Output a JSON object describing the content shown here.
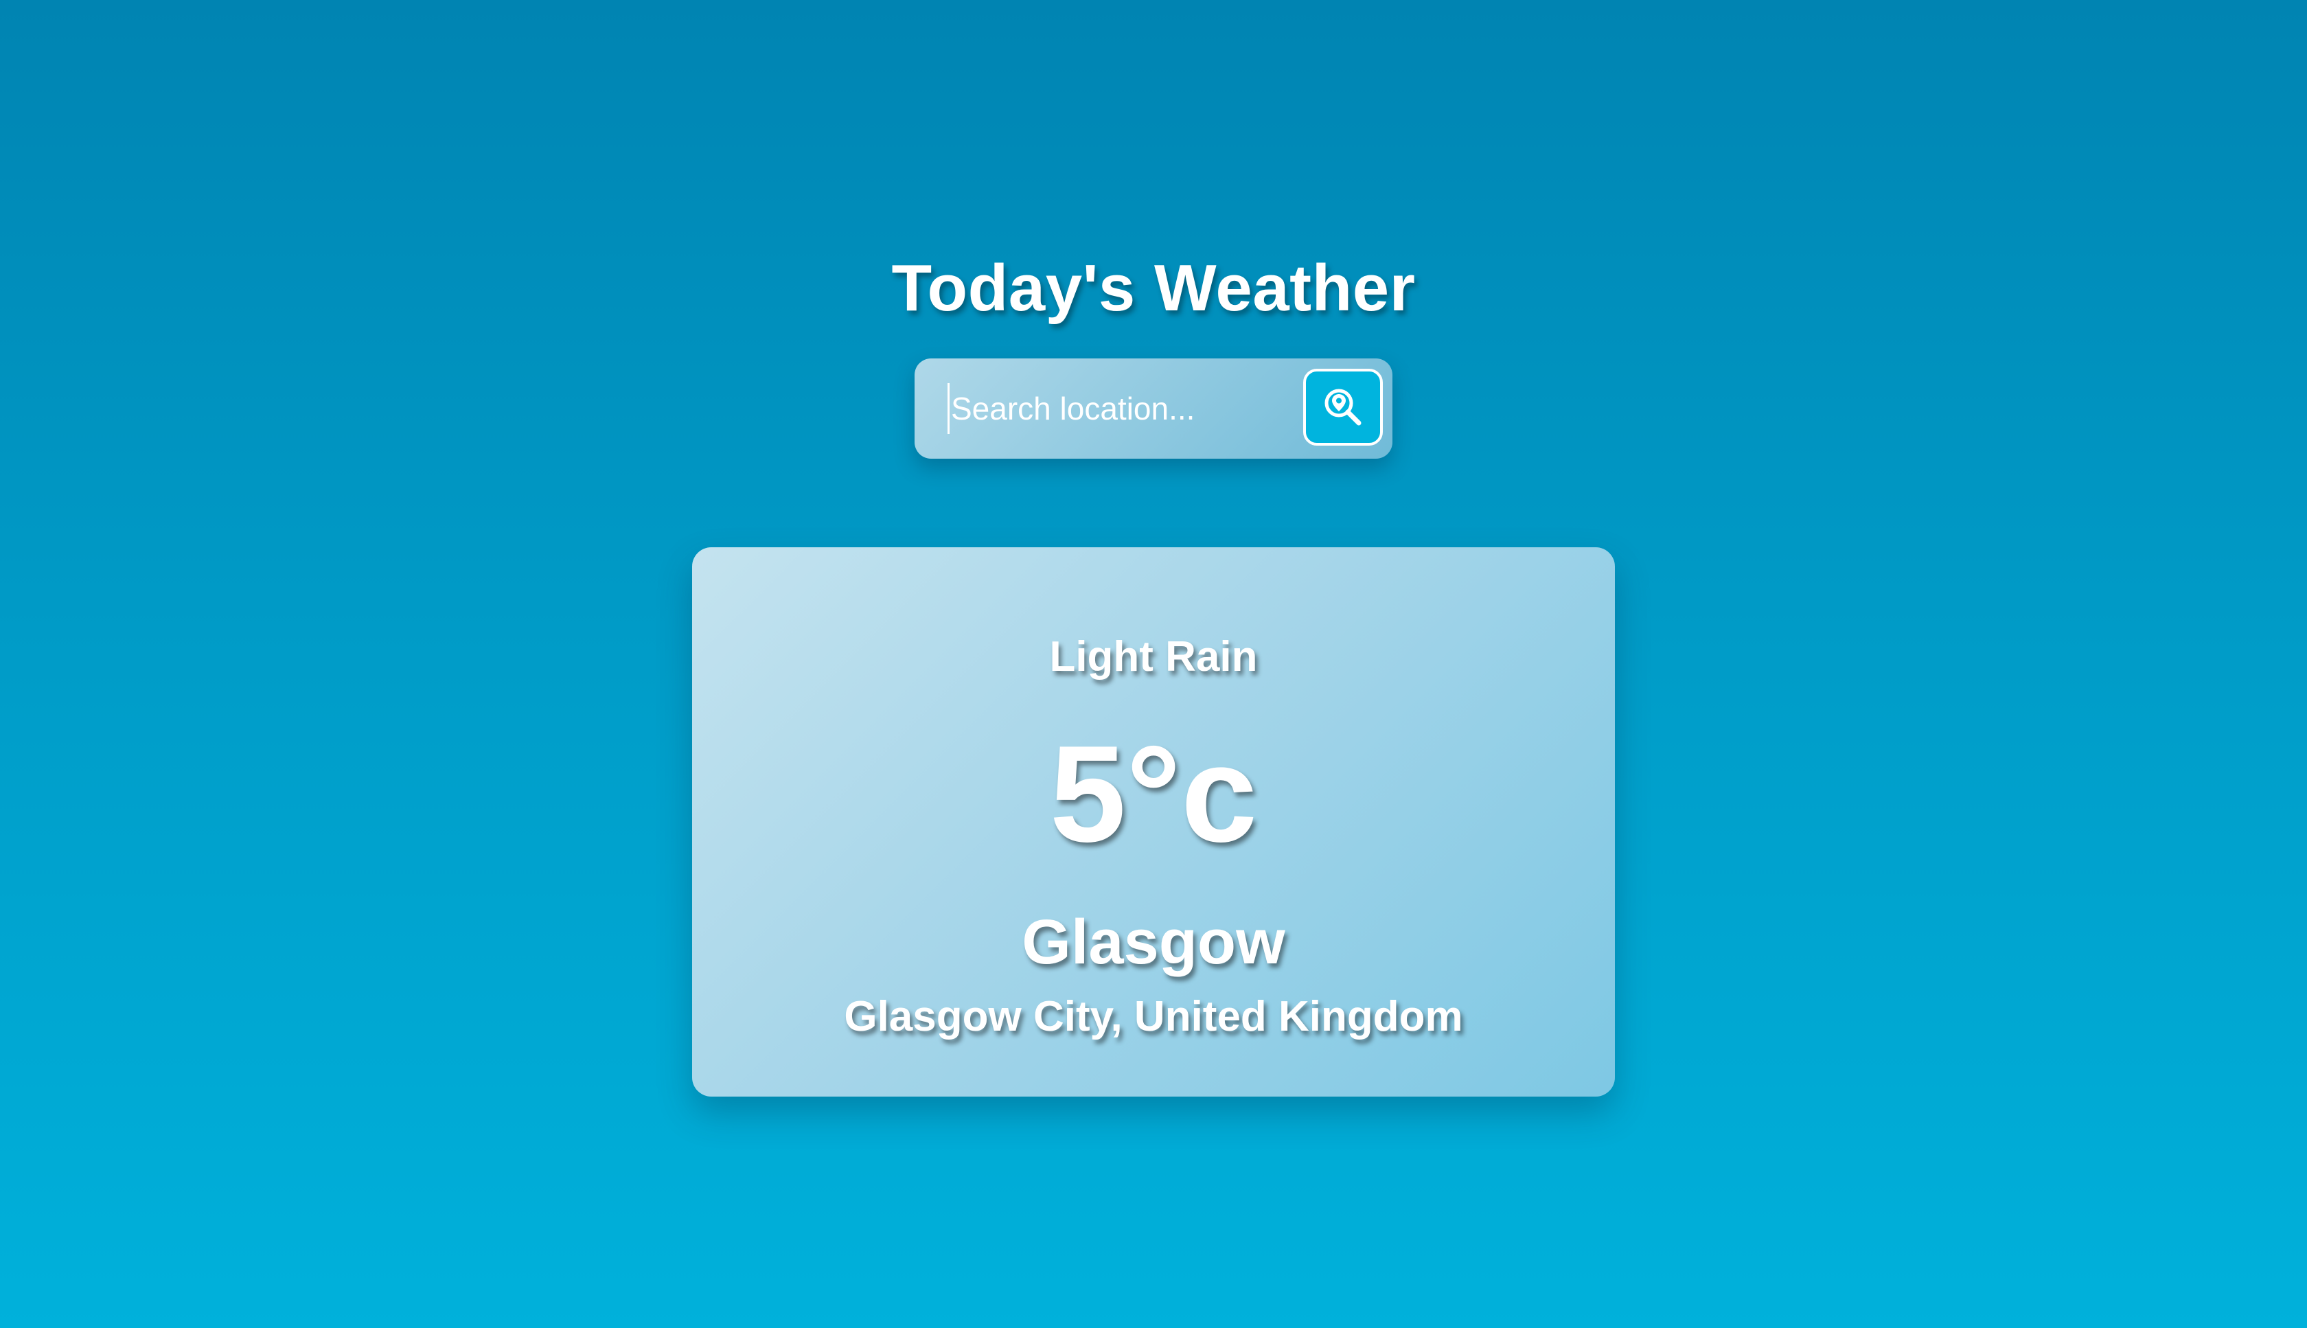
{
  "header": {
    "title": "Today's Weather"
  },
  "search": {
    "placeholder": "Search location...",
    "value": "",
    "button_icon": "location-search-icon"
  },
  "weather": {
    "condition": "Light Rain",
    "temperature": "5°c",
    "city": "Glasgow",
    "region": "Glasgow City, United Kingdom"
  },
  "colors": {
    "background_top": "#0084b2",
    "background_bottom": "#00b1db",
    "search_button": "#00b4de",
    "text": "#ffffff"
  }
}
